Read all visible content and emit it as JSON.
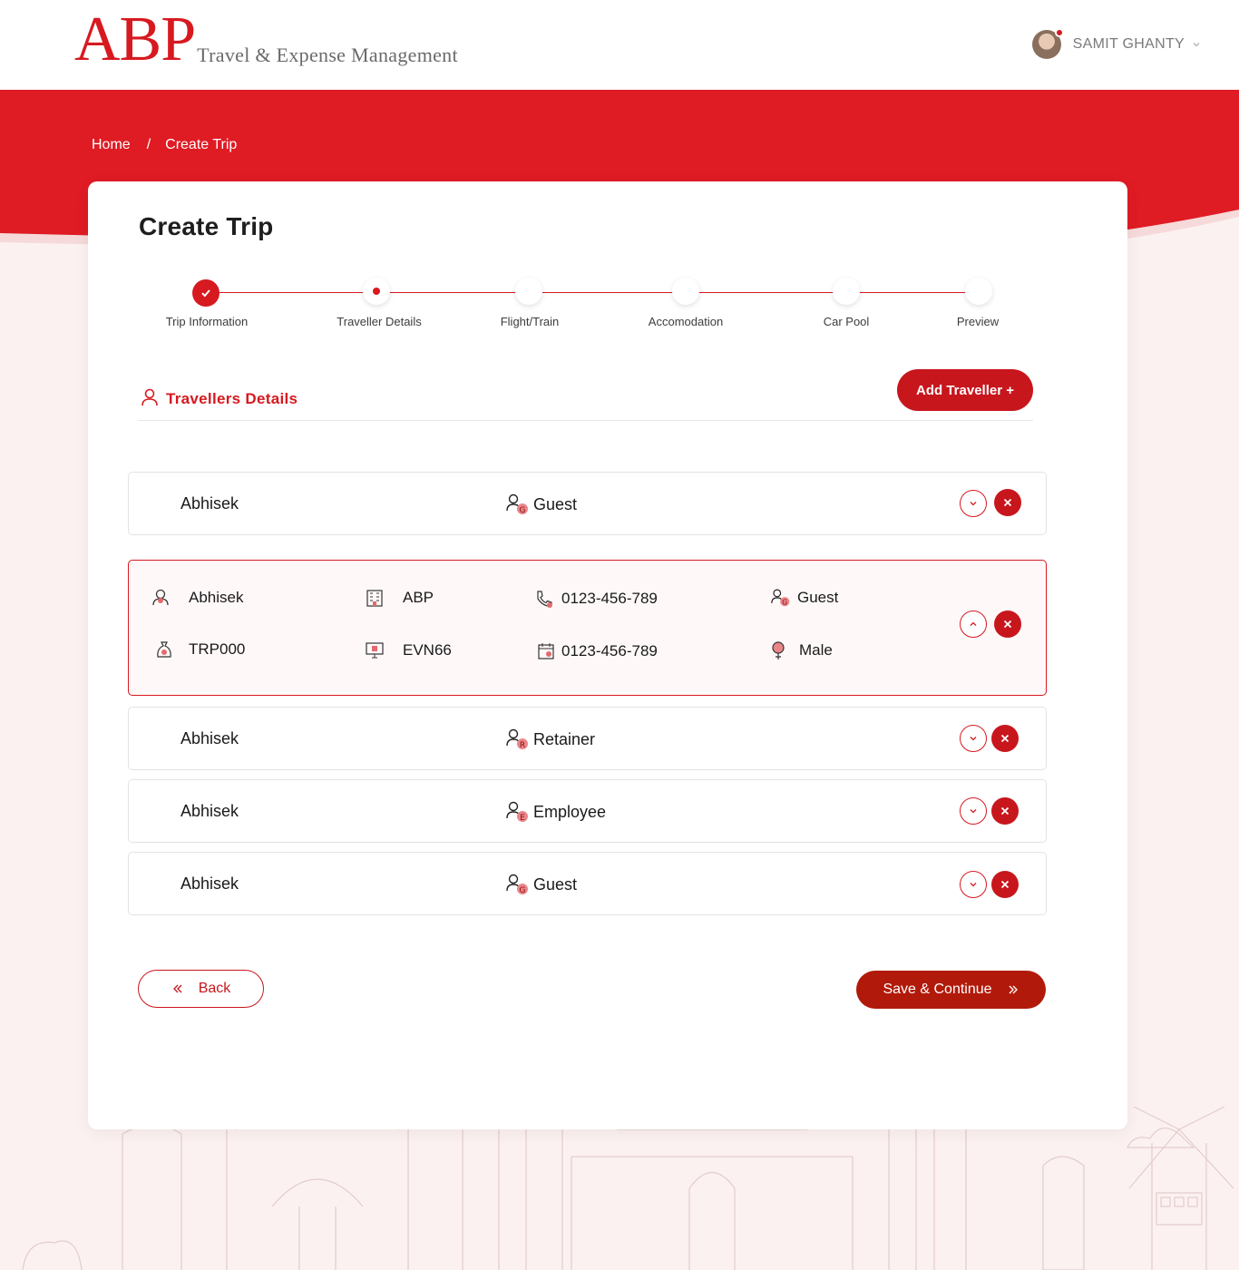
{
  "header": {
    "logo_mark": "ABP",
    "logo_text": "Travel & Expense Management",
    "user_name": "SAMIT GHANTY"
  },
  "breadcrumb": {
    "home": "Home",
    "separator": "/",
    "current": "Create Trip"
  },
  "page_title": "Create Trip",
  "stepper": {
    "steps": [
      {
        "label": "Trip Information",
        "state": "done"
      },
      {
        "label": "Traveller Details",
        "state": "active"
      },
      {
        "label": "Flight/Train",
        "state": "pending"
      },
      {
        "label": "Accomodation",
        "state": "pending"
      },
      {
        "label": "Car Pool",
        "state": "pending"
      },
      {
        "label": "Preview",
        "state": "pending"
      }
    ]
  },
  "section": {
    "title": "Travellers Details",
    "add_button": "Add Traveller +"
  },
  "travellers": [
    {
      "name": "Abhisek",
      "type": "Guest",
      "badge": "G",
      "expanded": false
    },
    {
      "name": "Abhisek",
      "type": "Guest",
      "badge": "G",
      "expanded": true,
      "details": {
        "company": "ABP",
        "phone": "0123-456-789",
        "employee_code": "TRP000",
        "event_code": "EVN66",
        "date": "0123-456-789",
        "gender": "Male"
      }
    },
    {
      "name": "Abhisek",
      "type": "Retainer",
      "badge": "R",
      "expanded": false
    },
    {
      "name": "Abhisek",
      "type": "Employee",
      "badge": "E",
      "expanded": false
    },
    {
      "name": "Abhisek",
      "type": "Guest",
      "badge": "G",
      "expanded": false
    }
  ],
  "actions": {
    "back": "Back",
    "save": "Save & Continue"
  },
  "colors": {
    "brand": "#d71920",
    "button": "#c8161d",
    "save": "#b11a0a",
    "background": "#fcf1f1"
  }
}
